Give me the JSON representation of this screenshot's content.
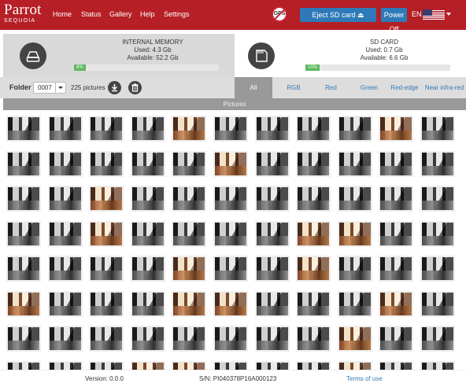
{
  "nav": {
    "brand": "Parrot",
    "brand_sub": "SEQUOIA",
    "links": [
      "Home",
      "Status",
      "Gallery",
      "Help",
      "Settings"
    ],
    "gps_label": "GPS",
    "eject_label": "Eject SD card",
    "power_label": "Power Off",
    "lang": "EN"
  },
  "memory": {
    "internal": {
      "title": "INTERNAL MEMORY",
      "used": "Used: 4.3 Gb",
      "available": "Available: 52.2 Gb",
      "percent": 8,
      "percent_label": "8%"
    },
    "sd": {
      "title": "SD CARD",
      "used": "Used: 0.7 Gb",
      "available": "Available: 6.6 Gb",
      "percent": 10,
      "percent_label": "10%"
    }
  },
  "toolbar": {
    "folder_label": "Folder",
    "folder_value": "0007",
    "count": "225 pictures",
    "tabs": [
      "All",
      "RGB",
      "Red",
      "Green",
      "Red-edge",
      "Near infra-red"
    ]
  },
  "pictures_header": "Pictures",
  "grid": {
    "columns": 11,
    "rows": 8,
    "color_cells": [
      4,
      9,
      16,
      24,
      35,
      40,
      41,
      48,
      51,
      55,
      59,
      60,
      64,
      74,
      80,
      81,
      85
    ]
  },
  "footer": {
    "version": "Version: 0.0.0",
    "serial": "S/N: PI040378P16A000123",
    "terms": "Terms of use"
  },
  "colors": {
    "nav": "#b51f25",
    "button": "#2e7ab8",
    "progress": "#5cb85c",
    "tab_active": "#999999",
    "link": "#337ab7"
  }
}
